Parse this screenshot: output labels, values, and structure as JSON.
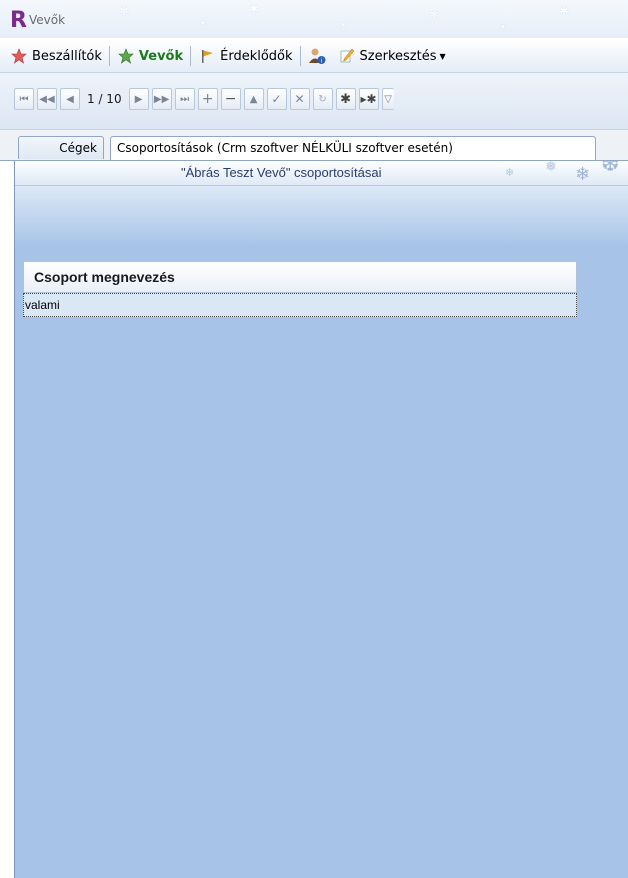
{
  "window": {
    "logo": "R",
    "title": "Vevők"
  },
  "menu": {
    "items": [
      {
        "label": "Beszállítók",
        "icon": "star-red-icon"
      },
      {
        "label": "Vevők",
        "icon": "star-green-icon",
        "active": true
      },
      {
        "label": "Érdeklődők",
        "icon": "flag-icon"
      },
      {
        "label": "",
        "icon": "user-info-icon"
      },
      {
        "label": "Szerkesztés",
        "icon": "edit-icon",
        "dropdown": true
      }
    ]
  },
  "navigator": {
    "position": "1 / 10",
    "buttons": [
      "first-record",
      "previous-page",
      "previous-record",
      "next-record",
      "next-page",
      "last-record",
      "add",
      "delete",
      "edit",
      "post",
      "cancel",
      "refresh",
      "set-bookmark",
      "goto-bookmark",
      "filter"
    ]
  },
  "tabs": [
    {
      "label": "Cégek",
      "active": false
    },
    {
      "label": "Csoportosítások (Crm szoftver NÉLKÜLI szoftver esetén)",
      "active": true
    }
  ],
  "panel": {
    "header": "\"Ábrás Teszt Vevő\" csoportosításai"
  },
  "grid": {
    "columns": [
      "Csoport megnevezés"
    ],
    "rows": [
      [
        "valami"
      ]
    ]
  },
  "colors": {
    "accent": "#7b2a8c",
    "active_menu": "#1c7a1c",
    "panel_bg": "#a7c4e8"
  }
}
